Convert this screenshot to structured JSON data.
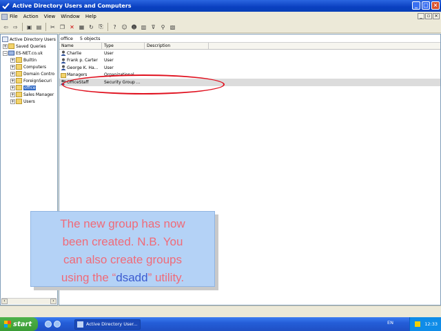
{
  "window": {
    "title": "Active Directory Users and Computers"
  },
  "menu": [
    "File",
    "Action",
    "View",
    "Window",
    "Help"
  ],
  "tree": {
    "root": "Active Directory Users",
    "items": [
      {
        "label": "Saved Queries",
        "expander": "+",
        "indent": 0
      },
      {
        "label": "ES-NET.co.uk",
        "expander": "−",
        "indent": 0
      },
      {
        "label": "Builtin",
        "expander": "+",
        "indent": 1
      },
      {
        "label": "Computers",
        "expander": "+",
        "indent": 1
      },
      {
        "label": "Domain Contro",
        "expander": "+",
        "indent": 1
      },
      {
        "label": "ForeignSecuri",
        "expander": "+",
        "indent": 1
      },
      {
        "label": "office",
        "expander": "+",
        "indent": 1,
        "selected": true
      },
      {
        "label": "Sales Manager",
        "expander": "+",
        "indent": 1
      },
      {
        "label": "Users",
        "expander": "+",
        "indent": 1
      }
    ]
  },
  "list": {
    "container": "office",
    "count": "5 objects",
    "columns": [
      "Name",
      "Type",
      "Description"
    ],
    "rows": [
      {
        "name": "Charlie",
        "type": "User"
      },
      {
        "name": "Frank p. Carter",
        "type": "User"
      },
      {
        "name": "George K. Ha...",
        "type": "User"
      },
      {
        "name": "Managers",
        "type": "Organizational ..."
      },
      {
        "name": "OfficeStaff",
        "type": "Security Group ..."
      }
    ]
  },
  "caption": {
    "line1": "The new group has now",
    "line2": "been created. N.B. You",
    "line3": "can also create groups",
    "line4_pre": "using the “",
    "line4_cmd": "dsadd",
    "line4_post": "” utility."
  },
  "taskbar": {
    "start": "start",
    "task": "Active Directory User...",
    "lang": "EN",
    "clock": "12:33"
  },
  "colors": {
    "highlight": "#e0101e",
    "caption_bg": "#b4d2f6",
    "caption_text": "#f06a78",
    "command_text": "#3b5bd0"
  }
}
